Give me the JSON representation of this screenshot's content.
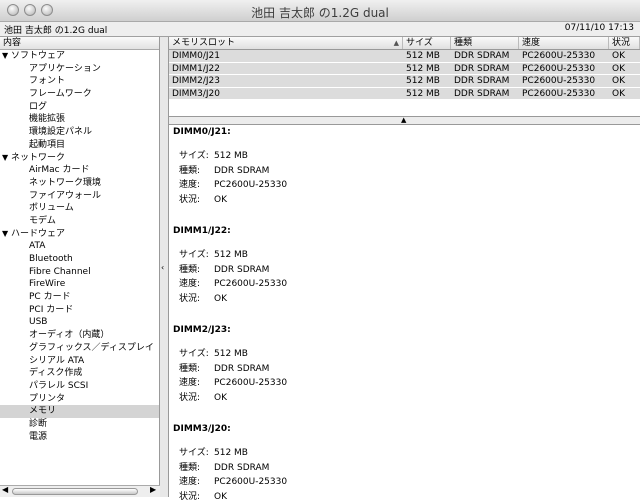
{
  "window": {
    "title": "池田 吉太郎 の1.2G dual"
  },
  "infobar": {
    "machine": "池田 吉太郎 の1.2G dual",
    "datetime": "07/11/10 17:13"
  },
  "sidebar": {
    "header": "内容",
    "tree": [
      {
        "label": "ソフトウェア",
        "type": "category",
        "expanded": true
      },
      {
        "label": "アプリケーション"
      },
      {
        "label": "フォント"
      },
      {
        "label": "フレームワーク"
      },
      {
        "label": "ログ"
      },
      {
        "label": "機能拡張"
      },
      {
        "label": "環境設定パネル"
      },
      {
        "label": "起動項目"
      },
      {
        "label": "ネットワーク",
        "type": "category",
        "expanded": true
      },
      {
        "label": "AirMac カード"
      },
      {
        "label": "ネットワーク環境"
      },
      {
        "label": "ファイアウォール"
      },
      {
        "label": "ボリューム"
      },
      {
        "label": "モデム"
      },
      {
        "label": "ハードウェア",
        "type": "category",
        "expanded": true
      },
      {
        "label": "ATA"
      },
      {
        "label": "Bluetooth"
      },
      {
        "label": "Fibre Channel"
      },
      {
        "label": "FireWire"
      },
      {
        "label": "PC カード"
      },
      {
        "label": "PCI カード"
      },
      {
        "label": "USB"
      },
      {
        "label": "オーディオ（内蔵）"
      },
      {
        "label": "グラフィックス／ディスプレイ"
      },
      {
        "label": "シリアル ATA"
      },
      {
        "label": "ディスク作成"
      },
      {
        "label": "パラレル SCSI"
      },
      {
        "label": "プリンタ"
      },
      {
        "label": "メモリ",
        "selected": true
      },
      {
        "label": "診断"
      },
      {
        "label": "電源"
      }
    ]
  },
  "table": {
    "columns": [
      "メモリスロット",
      "サイズ",
      "種類",
      "速度",
      "状況"
    ],
    "rows": [
      [
        "DIMM0/J21",
        "512 MB",
        "DDR SDRAM",
        "PC2600U-25330",
        "OK"
      ],
      [
        "DIMM1/J22",
        "512 MB",
        "DDR SDRAM",
        "PC2600U-25330",
        "OK"
      ],
      [
        "DIMM2/J23",
        "512 MB",
        "DDR SDRAM",
        "PC2600U-25330",
        "OK"
      ],
      [
        "DIMM3/J20",
        "512 MB",
        "DDR SDRAM",
        "PC2600U-25330",
        "OK"
      ]
    ]
  },
  "detail": {
    "keys": {
      "size": "サイズ:",
      "type": "種類:",
      "speed": "速度:",
      "status": "状況:"
    },
    "sections": [
      {
        "title": "DIMM0/J21:",
        "size": "512 MB",
        "type": "DDR SDRAM",
        "speed": "PC2600U-25330",
        "status": "OK"
      },
      {
        "title": "DIMM1/J22:",
        "size": "512 MB",
        "type": "DDR SDRAM",
        "speed": "PC2600U-25330",
        "status": "OK"
      },
      {
        "title": "DIMM2/J23:",
        "size": "512 MB",
        "type": "DDR SDRAM",
        "speed": "PC2600U-25330",
        "status": "OK"
      },
      {
        "title": "DIMM3/J20:",
        "size": "512 MB",
        "type": "DDR SDRAM",
        "speed": "PC2600U-25330",
        "status": "OK"
      }
    ]
  },
  "icons": {
    "close": "close-button",
    "minimize": "minimize-button",
    "zoom": "zoom-button",
    "expanded": "disclosure-triangle-down-icon",
    "sort": "sort-ascending-icon",
    "splitter": "splitter-arrow-icon"
  }
}
